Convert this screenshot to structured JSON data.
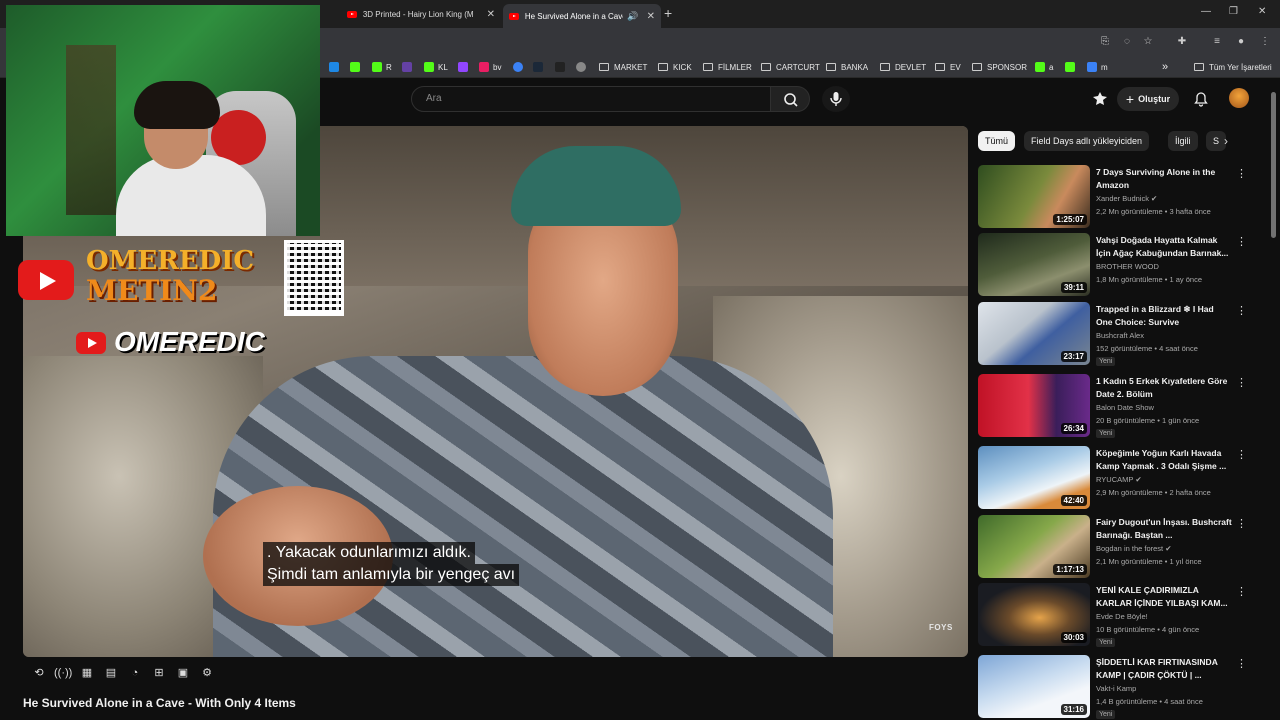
{
  "browser": {
    "tabs": [
      {
        "title": "3D Printed - Hairy Lion King (M",
        "close": "✕"
      },
      {
        "title": "He Survived Alone in a Cave",
        "close": "✕",
        "active": true
      }
    ],
    "new_tab": "+",
    "window": {
      "minimize": "—",
      "restore": "❐",
      "close": "✕"
    },
    "bookmarks": [
      {
        "label": "",
        "color": "#1e88e5"
      },
      {
        "label": "",
        "color": "#53fc18"
      },
      {
        "label": "R",
        "color": "#53fc18"
      },
      {
        "label": "",
        "color": "#6441a5"
      },
      {
        "label": "KL",
        "color": "#53fc18"
      },
      {
        "label": "",
        "color": "#9146ff"
      },
      {
        "label": "bv",
        "color": "#e91e63"
      },
      {
        "label": "",
        "color": "#3b82f6"
      },
      {
        "label": "",
        "color": "#1b2838"
      },
      {
        "label": "",
        "color": "#222222"
      },
      {
        "label": "",
        "color": "#888888"
      }
    ],
    "bookmark_folders": [
      "MARKET",
      "KICK",
      "FİLMLER",
      "CARTCURT",
      "BANKA",
      "DEVLET",
      "EV",
      "SPONSOR"
    ],
    "bookmark_tail": [
      "a",
      "m"
    ],
    "all_bookmarks": "Tüm Yer İşaretleri",
    "overflow": "»"
  },
  "masthead": {
    "search_placeholder": "Ara",
    "create_label": "Oluştur"
  },
  "player": {
    "subtitle_lines": [
      ".  Yakacak odunlarımızı aldık.",
      "Şimdi tam anlamıyla bir yengeç avı"
    ],
    "watermark": "FOYS",
    "video_title": "He Survived Alone in a Cave - With Only 4 Items"
  },
  "overlay": {
    "brand_line1": "OMEREDIC",
    "brand_line2": "METIN2",
    "handle": "OMEREDIC"
  },
  "sidebar": {
    "chips": [
      "Tümü",
      "Field Days adlı yükleyiciden",
      "İlgili",
      "S"
    ],
    "videos": [
      {
        "title": "7 Days Surviving Alone in the Amazon",
        "channel": "Xander Budnick ✔",
        "meta": "2,2 Mn görüntüleme • 3 hafta önce",
        "duration": "1:25:07",
        "badge": ""
      },
      {
        "title": "Vahşi Doğada Hayatta Kalmak İçin Ağaç Kabuğundan Barınak...",
        "channel": "BROTHER WOOD",
        "meta": "1,8 Mn görüntüleme • 1 ay önce",
        "duration": "39:11",
        "badge": ""
      },
      {
        "title": "Trapped in a Blizzard ❄ I Had One Choice: Survive",
        "channel": "Bushcraft Alex",
        "meta": "152 görüntüleme • 4 saat önce",
        "duration": "23:17",
        "badge": "Yeni"
      },
      {
        "title": "1 Kadın 5 Erkek Kıyafetlere Göre Date 2. Bölüm",
        "channel": "Balon Date Show",
        "meta": "20 B görüntüleme • 1 gün önce",
        "duration": "26:34",
        "badge": "Yeni"
      },
      {
        "title": "Köpeğimle Yoğun Karlı Havada Kamp Yapmak . 3 Odalı Şişme ...",
        "channel": "RYUCAMP ✔",
        "meta": "2,9 Mn görüntüleme • 2 hafta önce",
        "duration": "42:40",
        "badge": ""
      },
      {
        "title": "Fairy Dugout'un İnşası. Bushcraft Barınağı. Baştan ...",
        "channel": "Bogdan in the forest ✔",
        "meta": "2,1 Mn görüntüleme • 1 yıl önce",
        "duration": "1:17:13",
        "badge": ""
      },
      {
        "title": "YENİ KALE ÇADIRIMIZLA KARLAR İÇİNDE YILBAŞI KAM...",
        "channel": "Evde De Böyle!",
        "meta": "10 B görüntüleme • 4 gün önce",
        "duration": "30:03",
        "badge": "Yeni"
      },
      {
        "title": "ŞİDDETLİ KAR FIRTINASINDA KAMP | ÇADIR ÇÖKTÜ | ...",
        "channel": "Vakt-i Kamp",
        "meta": "1,4 B görüntüleme • 4 saat önce",
        "duration": "31:16",
        "badge": "Yeni"
      }
    ]
  },
  "colors": {
    "background": "#0f0f0f",
    "accent": "#ff0000",
    "chip_active": "#f1f1f1"
  }
}
